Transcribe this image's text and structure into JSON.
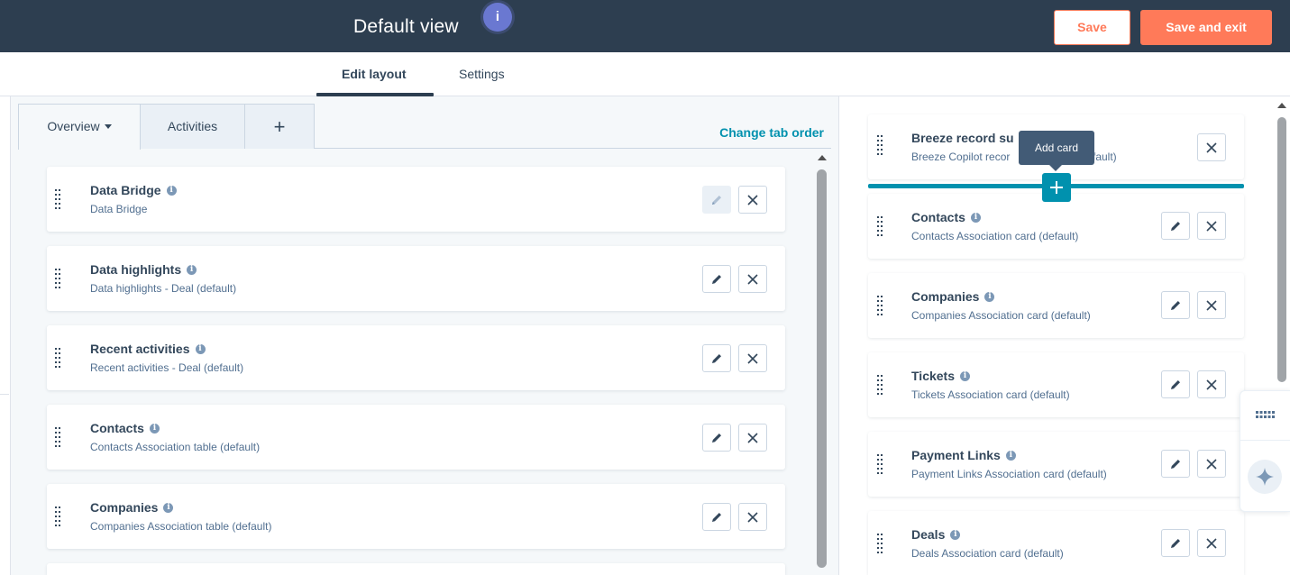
{
  "header": {
    "title": "Default view",
    "info_badge": "i",
    "save_label": "Save",
    "save_exit_label": "Save and exit"
  },
  "subtabs": [
    {
      "label": "Edit layout",
      "active": true
    },
    {
      "label": "Settings",
      "active": false
    }
  ],
  "layout_tabs": {
    "items": [
      {
        "label": "Overview",
        "active": true,
        "has_dropdown": true
      },
      {
        "label": "Activities",
        "active": false
      },
      {
        "label": "+",
        "active": false
      }
    ],
    "change_tab_order_label": "Change tab order"
  },
  "middle_cards": [
    {
      "title": "Data Bridge",
      "subtitle": "Data Bridge",
      "edit_disabled": true
    },
    {
      "title": "Data highlights",
      "subtitle": "Data highlights - Deal (default)",
      "edit_disabled": false
    },
    {
      "title": "Recent activities",
      "subtitle": "Recent activities - Deal (default)",
      "edit_disabled": false
    },
    {
      "title": "Contacts",
      "subtitle": "Contacts Association table (default)",
      "edit_disabled": false
    },
    {
      "title": "Companies",
      "subtitle": "Companies Association table (default)",
      "edit_disabled": false
    }
  ],
  "right_cards": [
    {
      "title": "Breeze record su",
      "subtitle": "Breeze Copilot recor",
      "subtitle_tail": "fault)"
    },
    {
      "title": "Contacts",
      "subtitle": "Contacts Association card (default)"
    },
    {
      "title": "Companies",
      "subtitle": "Companies Association card (default)"
    },
    {
      "title": "Tickets",
      "subtitle": "Tickets Association card (default)"
    },
    {
      "title": "Payment Links",
      "subtitle": "Payment Links Association card (default)"
    },
    {
      "title": "Deals",
      "subtitle": "Deals Association card (default)"
    }
  ],
  "tooltip": {
    "label": "Add card"
  },
  "icons": {
    "edit": "pencil-icon",
    "remove": "close-icon",
    "drag": "drag-handle-icon",
    "info": "info-icon",
    "add": "plus-icon",
    "apps": "grid-dots-icon",
    "copilot": "sparkle-icon"
  },
  "colors": {
    "header_bg": "#2d3e50",
    "accent_orange": "#ff7a59",
    "accent_teal": "#0091ae",
    "info_badge": "#6a78d1"
  }
}
